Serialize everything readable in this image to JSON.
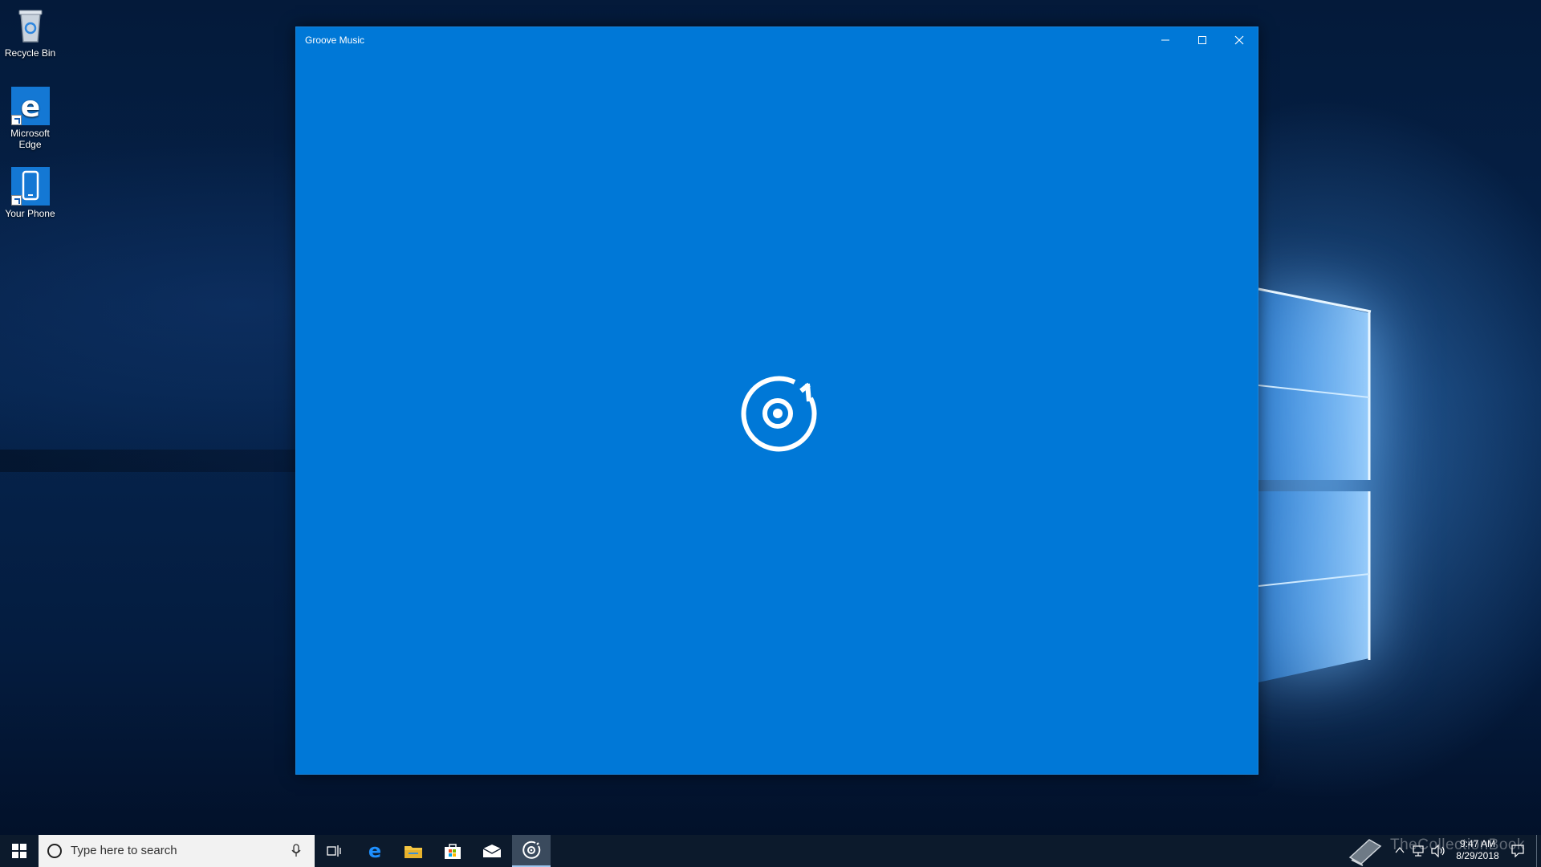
{
  "desktop": {
    "icons": [
      {
        "label": "Recycle Bin",
        "icon": "recycle-bin-icon"
      },
      {
        "label": "Microsoft Edge",
        "icon": "edge-icon"
      },
      {
        "label": "Your Phone",
        "icon": "phone-icon"
      }
    ]
  },
  "window": {
    "title": "Groove Music",
    "background": "#0078d7",
    "logo": "groove-music-logo-icon"
  },
  "taskbar": {
    "search_placeholder": "Type here to search",
    "pinned": [
      "start-icon",
      "task-view-icon",
      "edge-icon",
      "file-explorer-icon",
      "store-icon",
      "mail-icon",
      "groove-music-icon"
    ],
    "clock_time": "9:47 AM",
    "clock_date": "8/29/2018"
  },
  "watermark": "TheCollectionBook"
}
